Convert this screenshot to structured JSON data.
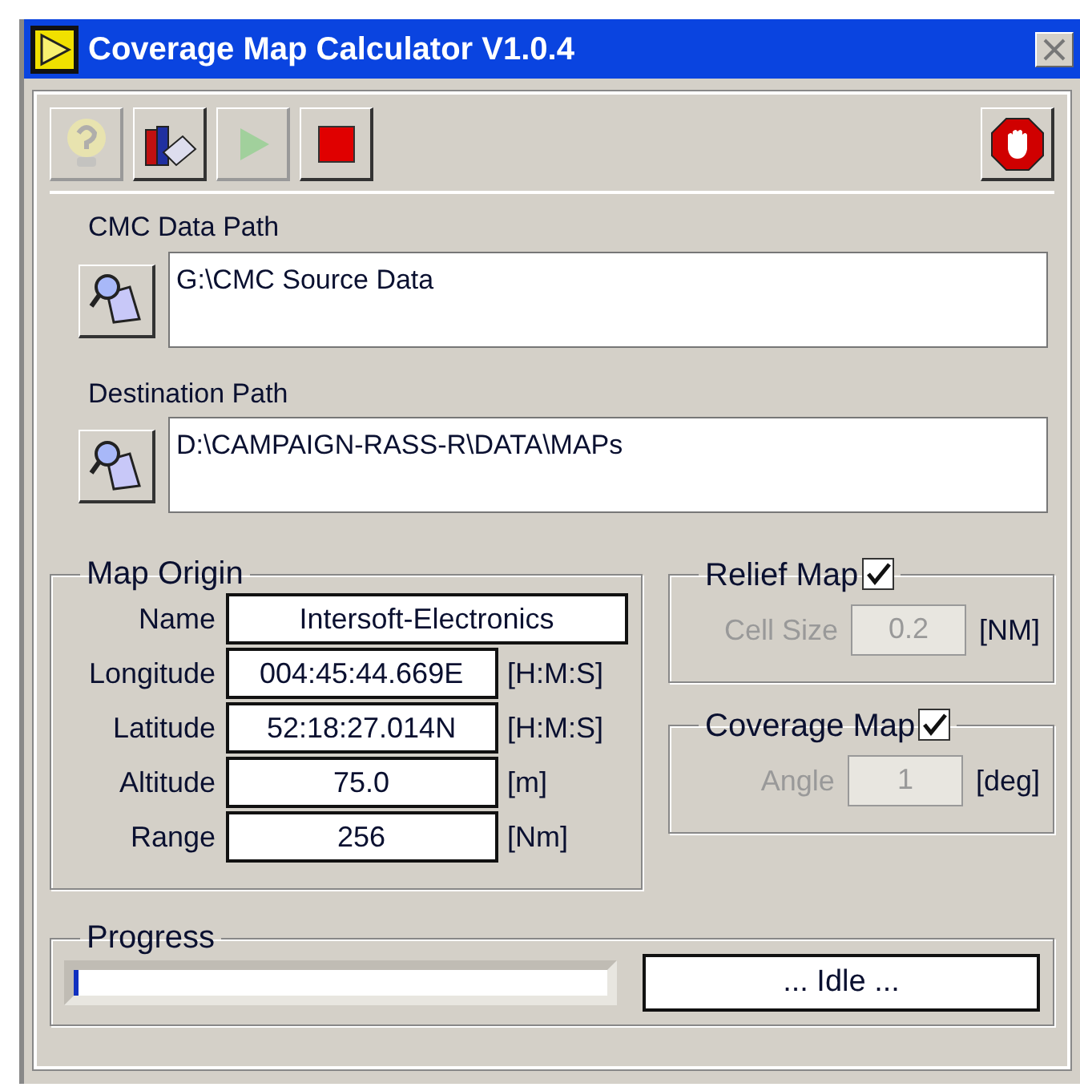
{
  "window": {
    "title": "Coverage Map Calculator V1.0.4"
  },
  "toolbar": [
    {
      "kind": "help",
      "disabled": true
    },
    {
      "kind": "books",
      "disabled": false
    },
    {
      "kind": "run",
      "disabled": true
    },
    {
      "kind": "stop",
      "disabled": false
    }
  ],
  "abort_button": {
    "kind": "abort",
    "disabled": false
  },
  "paths": [
    {
      "label": "CMC Data Path",
      "value": "G:\\CMC Source Data"
    },
    {
      "label": "Destination Path",
      "value": "D:\\CAMPAIGN-RASS-R\\DATA\\MAPs"
    }
  ],
  "map_origin": {
    "title": "Map Origin",
    "fields": [
      {
        "label": "Name",
        "value": "Intersoft-Electronics"
      },
      {
        "label": "Longitude",
        "value": "004:45:44.669E",
        "unit": "[H:M:S]"
      },
      {
        "label": "Latitude",
        "value": "52:18:27.014N",
        "unit": "[H:M:S]"
      },
      {
        "label": "Altitude",
        "value": "75.0",
        "unit": "[m]"
      },
      {
        "label": "Range",
        "value": "256",
        "unit": "[Nm]"
      }
    ]
  },
  "options": [
    {
      "title": "Relief Map",
      "checked": true,
      "label": "Cell Size",
      "value": "0.2",
      "unit": "[NM]",
      "disabled": true
    },
    {
      "title": "Coverage Map",
      "checked": true,
      "label": "Angle",
      "value": "1",
      "unit": "[deg]",
      "disabled": true
    }
  ],
  "progress": {
    "title": "Progress",
    "level": 0.01,
    "status": "... Idle ..."
  }
}
